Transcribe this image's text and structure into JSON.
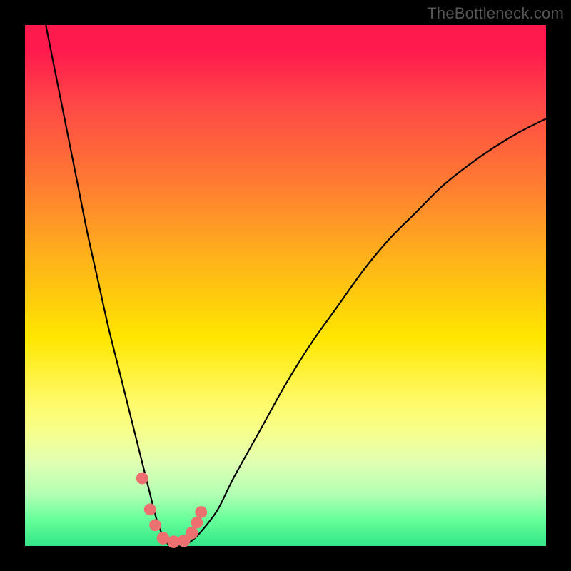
{
  "watermark": "TheBottleneck.com",
  "chart_data": {
    "type": "line",
    "title": "",
    "xlabel": "",
    "ylabel": "",
    "xlim": [
      0,
      100
    ],
    "ylim": [
      0,
      100
    ],
    "series": [
      {
        "name": "bottleneck-curve",
        "x": [
          4,
          6,
          8,
          10,
          12,
          14,
          16,
          18,
          20,
          22,
          23,
          24,
          25,
          26,
          27,
          28,
          30,
          32,
          34,
          37,
          40,
          45,
          50,
          55,
          60,
          65,
          70,
          75,
          80,
          85,
          90,
          95,
          100
        ],
        "values": [
          100,
          90,
          80,
          70,
          60,
          51,
          42,
          34,
          26,
          18,
          14,
          10,
          6,
          3,
          1,
          0,
          0,
          1,
          3,
          7,
          13,
          22,
          31,
          39,
          46,
          53,
          59,
          64,
          69,
          73,
          76.5,
          79.5,
          82
        ]
      }
    ],
    "markers": [
      {
        "x": 22.5,
        "y": 13,
        "r": 1.2
      },
      {
        "x": 24.0,
        "y": 7,
        "r": 1.2
      },
      {
        "x": 25.0,
        "y": 4,
        "r": 1.2
      },
      {
        "x": 26.5,
        "y": 1.5,
        "r": 1.4
      },
      {
        "x": 28.5,
        "y": 0.8,
        "r": 1.4
      },
      {
        "x": 30.5,
        "y": 1.0,
        "r": 1.4
      },
      {
        "x": 32.0,
        "y": 2.5,
        "r": 1.4
      },
      {
        "x": 33.0,
        "y": 4.5,
        "r": 1.2
      },
      {
        "x": 33.8,
        "y": 6.5,
        "r": 1.2
      }
    ],
    "gradient_stops": [
      {
        "pct": 0,
        "color": "#ff1a4d"
      },
      {
        "pct": 15,
        "color": "#ff4747"
      },
      {
        "pct": 30,
        "color": "#ff7a33"
      },
      {
        "pct": 45,
        "color": "#ffb31a"
      },
      {
        "pct": 60,
        "color": "#ffe600"
      },
      {
        "pct": 78,
        "color": "#f7ff8c"
      },
      {
        "pct": 90,
        "color": "#b3ffb3"
      },
      {
        "pct": 100,
        "color": "#33e688"
      }
    ],
    "marker_color": "#ec7070",
    "curve_color": "#000000"
  }
}
